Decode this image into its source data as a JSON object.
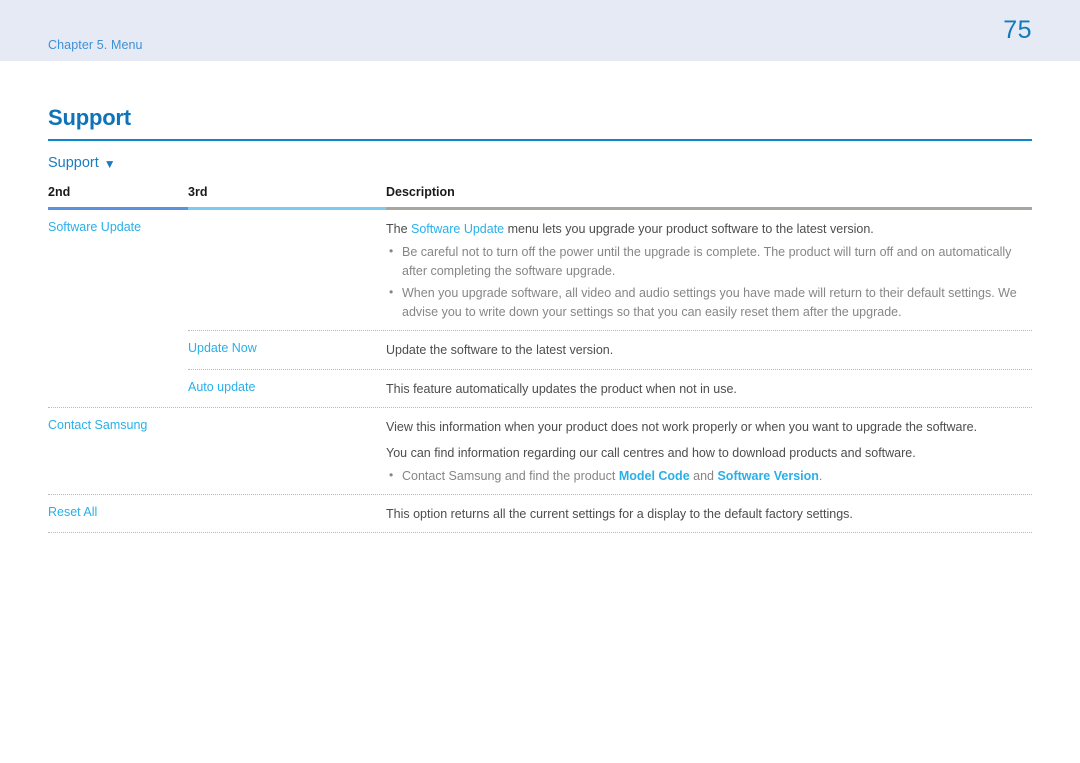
{
  "header": {
    "chapter_label": "Chapter 5. Menu",
    "page_number": "75",
    "band_color": "#e6eaf5",
    "accent_color": "#1379bd"
  },
  "section": {
    "title": "Support",
    "rule_color": "#0c87ce",
    "menu_path": "Support",
    "menu_caret_icon": "triangle-down-icon",
    "menu_caret_glyph": "▼"
  },
  "table": {
    "columns": [
      {
        "key": "second",
        "label": "2nd",
        "rule_color": "#5b92e0"
      },
      {
        "key": "third",
        "label": "3rd",
        "rule_color": "#79cdf0"
      },
      {
        "key": "description",
        "label": "Description",
        "rule_color": "#a8a6a0"
      }
    ],
    "rows": [
      {
        "second": "Software Update",
        "third": "",
        "description_lead_pre": "The ",
        "description_lead_hl": "Software Update",
        "description_lead_post": " menu lets you upgrade your product software to the latest version.",
        "bullets": [
          "Be careful not to turn off the power until the upgrade is complete. The product will turn off and on automatically after completing the software upgrade.",
          "When you upgrade software, all video and audio settings you have made will return to their default settings. We advise you to write down your settings so that you can easily reset them after the upgrade."
        ]
      },
      {
        "second": "",
        "third": "Update Now",
        "description": "Update the software to the latest version."
      },
      {
        "second": "",
        "third": "Auto update",
        "description": "This feature automatically updates the product when not in use."
      },
      {
        "second": "Contact Samsung",
        "third": "",
        "description_line_1": "View this information when your product does not work properly or when you want to upgrade the software.",
        "description_line_2": "You can find information regarding our call centres and how to download products and software.",
        "bullet_pre": "Contact Samsung and find the product ",
        "bullet_hl_1": "Model Code",
        "bullet_mid": " and ",
        "bullet_hl_2": "Software Version",
        "bullet_post": "."
      },
      {
        "second": "Reset All",
        "third": "",
        "description": "This option returns all the current settings for a display to the default factory settings."
      }
    ]
  },
  "colors": {
    "link_cyan": "#29b0e8",
    "heading_blue": "#0f73b8",
    "body_gray": "#4d4d4d",
    "bullet_gray": "#868686"
  }
}
